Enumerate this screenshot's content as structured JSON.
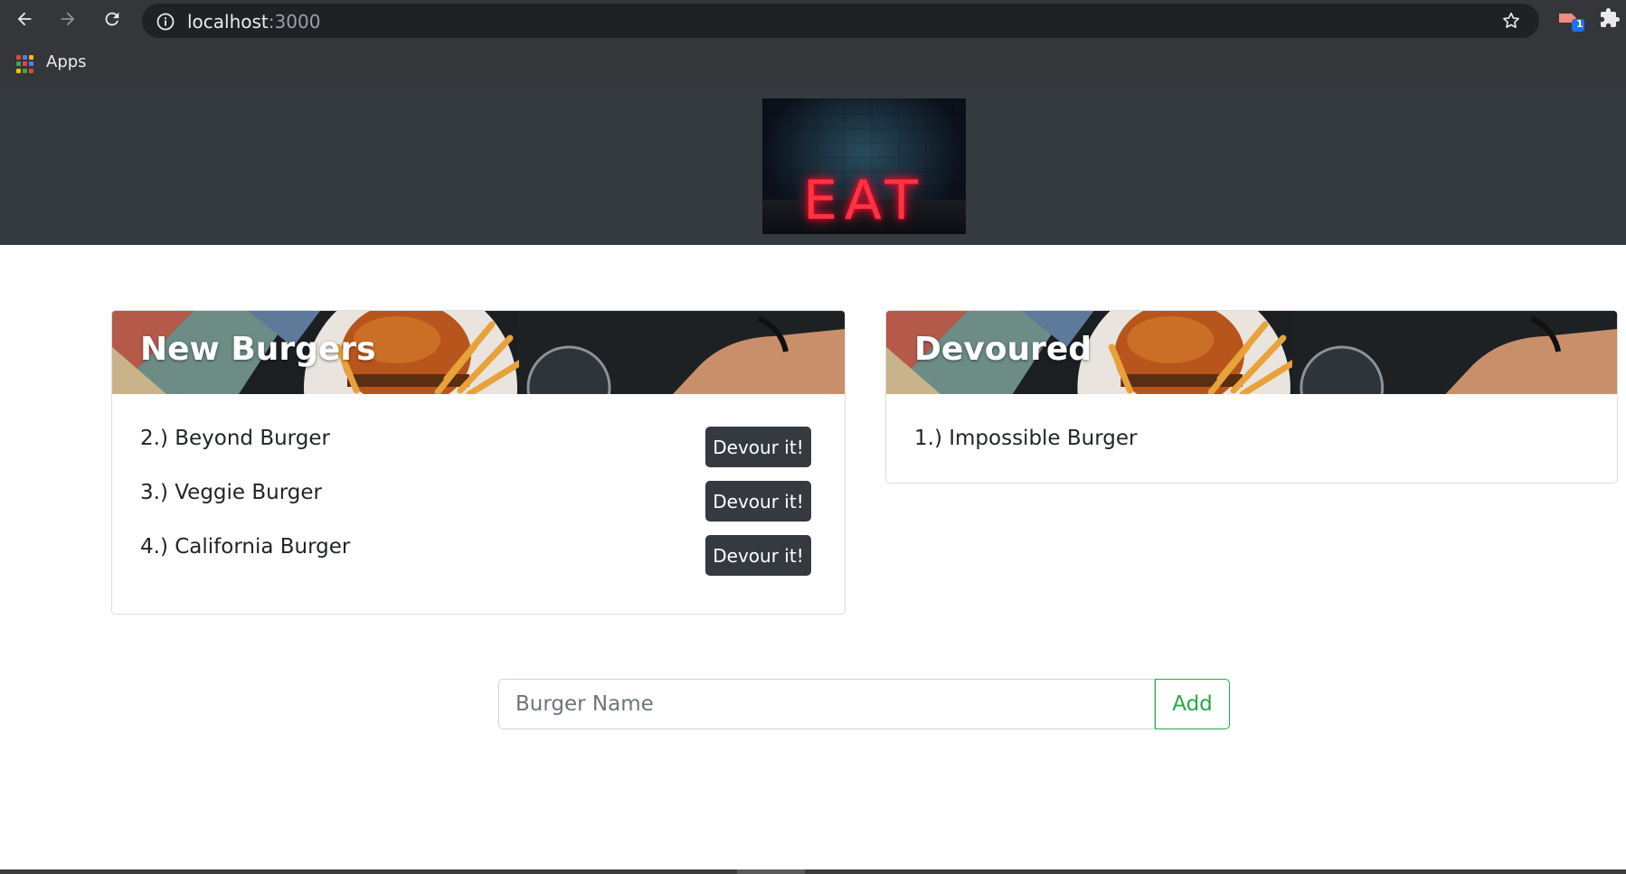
{
  "browser": {
    "url_host": "localhost",
    "url_port": ":3000",
    "bookmark_apps_label": "Apps",
    "extension_badge": "1"
  },
  "header": {
    "logo_text": "EAT"
  },
  "new_burgers": {
    "title": "New Burgers",
    "items": [
      {
        "label": "2.) Beyond Burger",
        "button": "Devour it!"
      },
      {
        "label": "3.) Veggie Burger",
        "button": "Devour it!"
      },
      {
        "label": "4.) California Burger",
        "button": "Devour it!"
      }
    ]
  },
  "devoured": {
    "title": "Devoured",
    "items": [
      {
        "label": "1.) Impossible Burger"
      }
    ]
  },
  "form": {
    "placeholder": "Burger Name",
    "add_label": "Add"
  },
  "colors": {
    "header_bg": "#343a40",
    "button_dark": "#343a40",
    "success": "#28a745"
  }
}
